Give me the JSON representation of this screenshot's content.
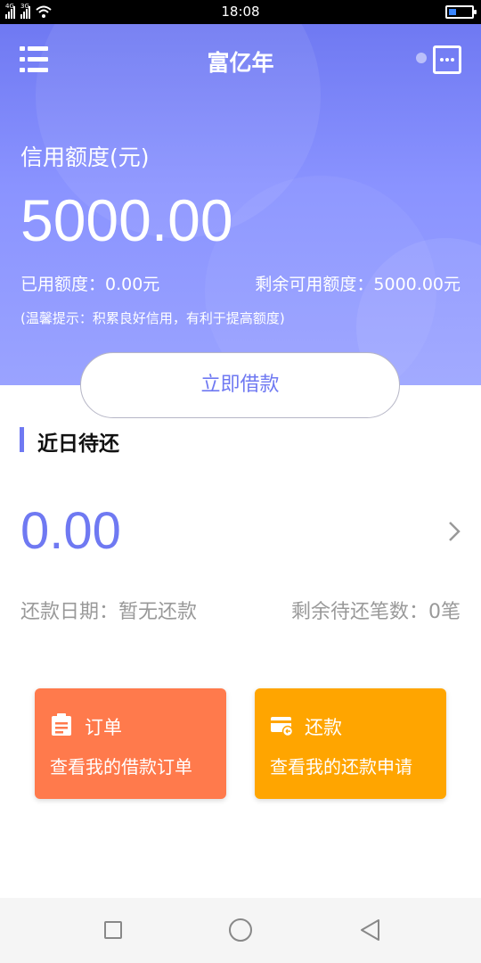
{
  "status_bar": {
    "time": "18:08",
    "net1": "4G",
    "net2": "3G"
  },
  "header": {
    "title": "富亿年"
  },
  "credit": {
    "label": "信用额度(元)",
    "amount": "5000.00",
    "used": "已用额度：0.00元",
    "remaining": "剩余可用额度：5000.00元",
    "tip": "(温馨提示：积累良好信用，有利于提高额度)"
  },
  "borrow_button": "立即借款",
  "repayment": {
    "section_title": "近日待还",
    "amount": "0.00",
    "date": "还款日期：暂无还款",
    "remaining_count": "剩余待还笔数：0笔"
  },
  "cards": {
    "order": {
      "title": "订单",
      "desc": "查看我的借款订单",
      "color": "#ff7a4c"
    },
    "repay": {
      "title": "还款",
      "desc": "查看我的还款申请",
      "color": "#ffa500"
    }
  },
  "colors": {
    "accent": "#6f79f2"
  },
  "icons": [
    "menu-icon",
    "chat-icon",
    "chevron-right-icon",
    "clipboard-icon",
    "card-icon"
  ]
}
